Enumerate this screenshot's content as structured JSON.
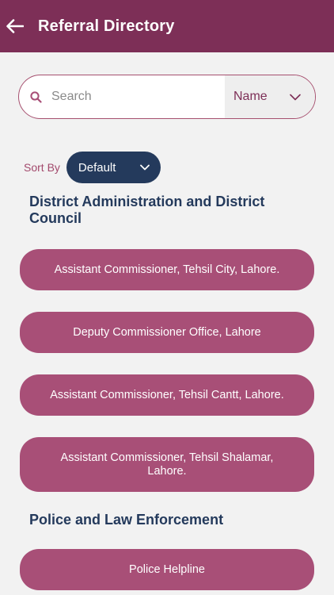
{
  "header": {
    "title": "Referral Directory"
  },
  "search": {
    "placeholder": "Search",
    "filter_selected": "Name"
  },
  "sort": {
    "label": "Sort By",
    "selected": "Default"
  },
  "sections": [
    {
      "title": "District Administration and District Council",
      "items": [
        "Assistant Commissioner, Tehsil City, Lahore.",
        "Deputy Commissioner Office, Lahore",
        "Assistant Commissioner, Tehsil Cantt, Lahore.",
        "Assistant Commissioner, Tehsil Shalamar, Lahore."
      ]
    },
    {
      "title": "Police and Law Enforcement",
      "items": [
        "Police Helpline"
      ]
    }
  ],
  "colors": {
    "appbar": "#7d2f57",
    "button": "#a84f77",
    "navy": "#243a5c",
    "background": "#f2f2f2"
  },
  "icons": {
    "back": "arrow-left",
    "search": "magnifier",
    "dropdown": "chevron-down"
  }
}
